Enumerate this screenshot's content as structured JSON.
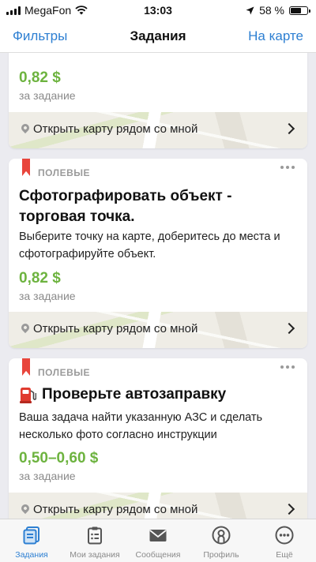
{
  "status_bar": {
    "carrier": "MegaFon",
    "time": "13:03",
    "battery_text": "58 %",
    "battery_level": 0.58
  },
  "nav": {
    "left": "Фильтры",
    "title": "Задания",
    "right": "На карте"
  },
  "cards": [
    {
      "price": "0,82 $",
      "per_task": "за задание",
      "map_link": "Открыть карту рядом со мной"
    },
    {
      "category": "ПОЛЕВЫЕ",
      "title_line1": "Сфотографировать объект -",
      "title_line2": "торговая точка.",
      "desc_line1": "Выберите точку на карте, доберитесь до места и",
      "desc_line2": "сфотографируйте объект.",
      "price": "0,82 $",
      "per_task": "за задание",
      "map_link": "Открыть карту рядом со мной"
    },
    {
      "category": "ПОЛЕВЫЕ",
      "title": "Проверьте автозаправку",
      "desc_line1": "Ваша задача найти указанную АЗС и сделать",
      "desc_line2": "несколько фото согласно инструкции",
      "price": "0,50–0,60 $",
      "per_task": "за задание",
      "map_link": "Открыть карту рядом со мной"
    }
  ],
  "tabs": [
    {
      "label": "Задания",
      "icon": "tasks-icon",
      "active": true
    },
    {
      "label": "Мои задания",
      "icon": "clipboard-icon",
      "active": false
    },
    {
      "label": "Сообщения",
      "icon": "envelope-icon",
      "active": false
    },
    {
      "label": "Профиль",
      "icon": "profile-icon",
      "active": false
    },
    {
      "label": "Ещё",
      "icon": "more-icon",
      "active": false
    }
  ],
  "colors": {
    "accent": "#2d7fd2",
    "price": "#6db33f",
    "bookmark": "#e8453c"
  }
}
